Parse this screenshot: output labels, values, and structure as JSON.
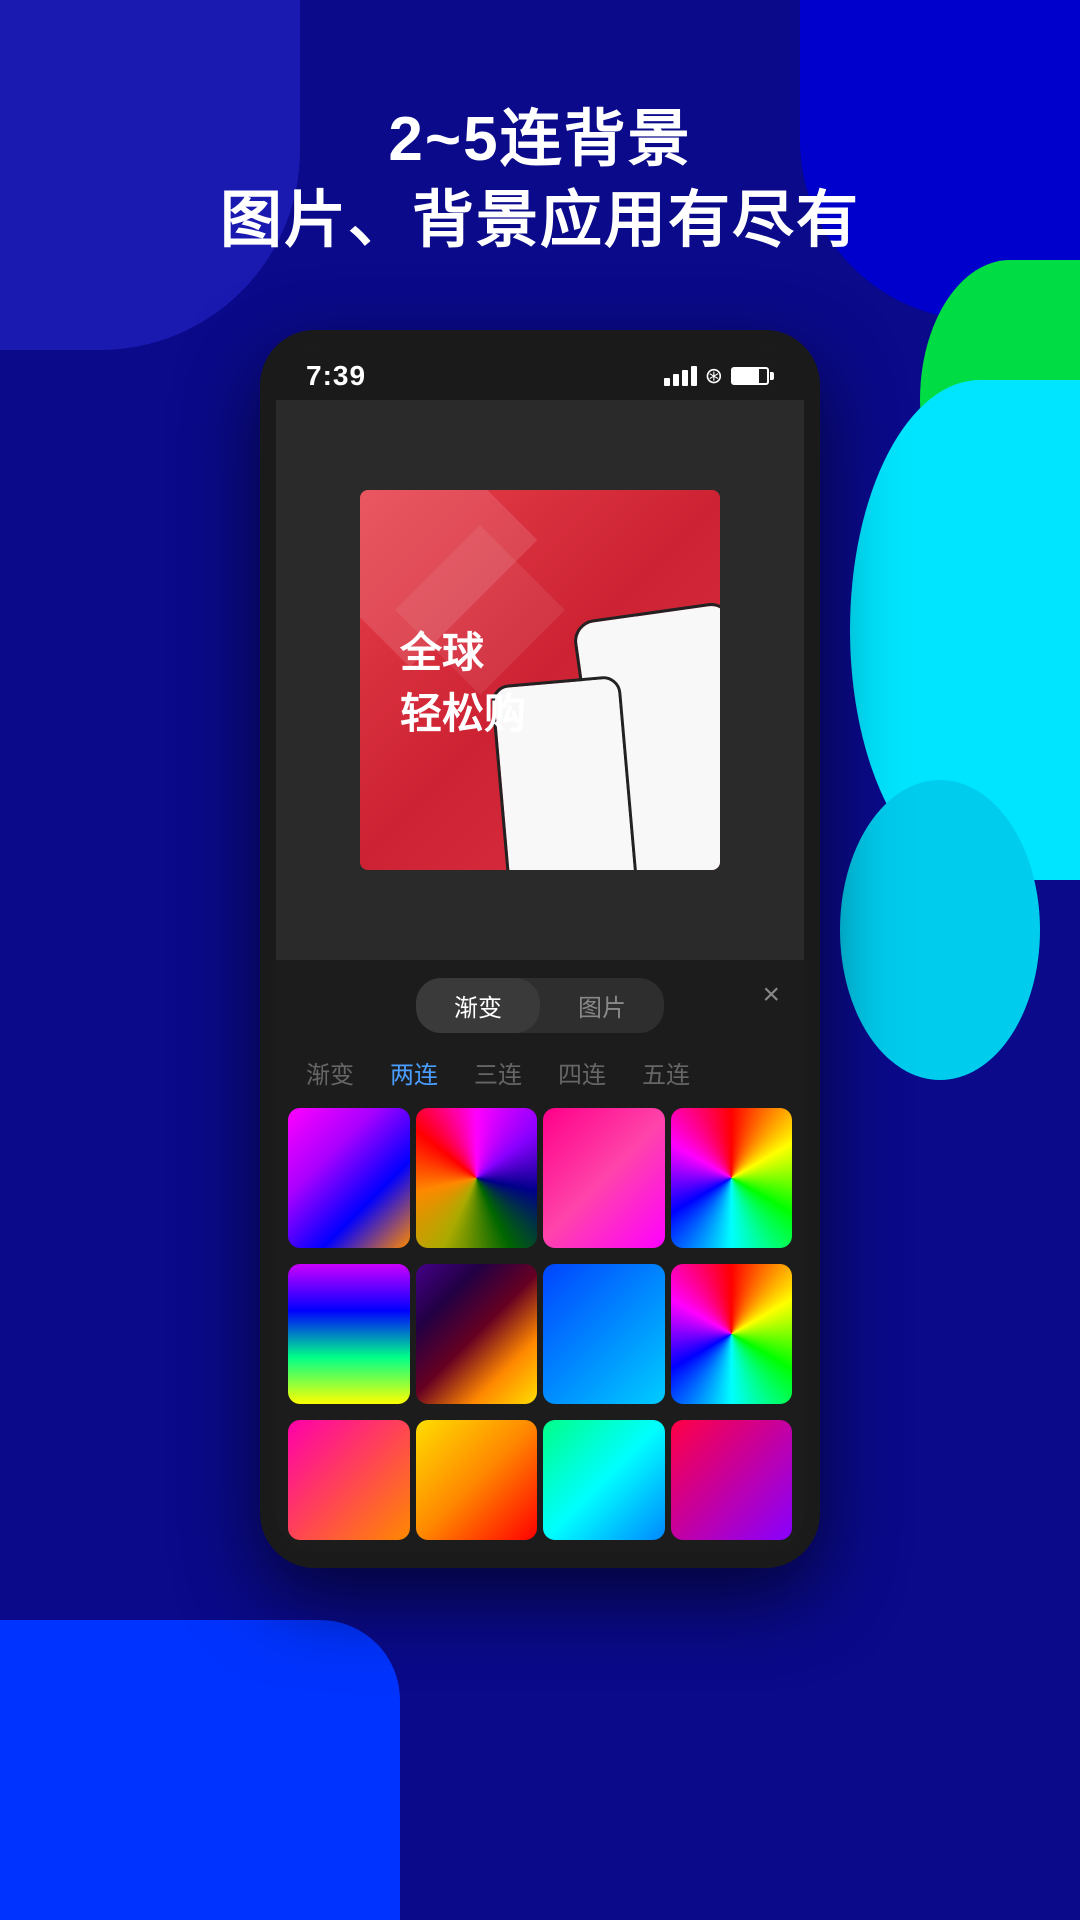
{
  "background": {
    "color": "#0a0a8a"
  },
  "header": {
    "line1": "2~5连背景",
    "line2": "图片、背景应用有尽有"
  },
  "statusBar": {
    "time": "7:39",
    "signalBars": [
      8,
      12,
      16,
      20
    ],
    "wifi": "wifi",
    "battery": 75
  },
  "card": {
    "text_line1": "全球",
    "text_line2": "轻松购"
  },
  "tabs": {
    "tab1": "渐变",
    "tab2": "图片",
    "closeLabel": "×"
  },
  "filterTabs": {
    "items": [
      "渐变",
      "两连",
      "三连",
      "四连",
      "五连"
    ],
    "activeIndex": 1
  },
  "gradients": {
    "row1": [
      {
        "type": "gradient-1"
      },
      {
        "type": "gradient-2"
      },
      {
        "type": "gradient-3"
      },
      {
        "type": "gradient-4"
      }
    ],
    "row2": [
      {
        "type": "gradient-5"
      },
      {
        "type": "gradient-6"
      },
      {
        "type": "gradient-7"
      },
      {
        "type": "gradient-8"
      }
    ],
    "row3": [
      {
        "type": "g1"
      },
      {
        "type": "g2"
      },
      {
        "type": "g3"
      },
      {
        "type": "g4"
      }
    ]
  }
}
